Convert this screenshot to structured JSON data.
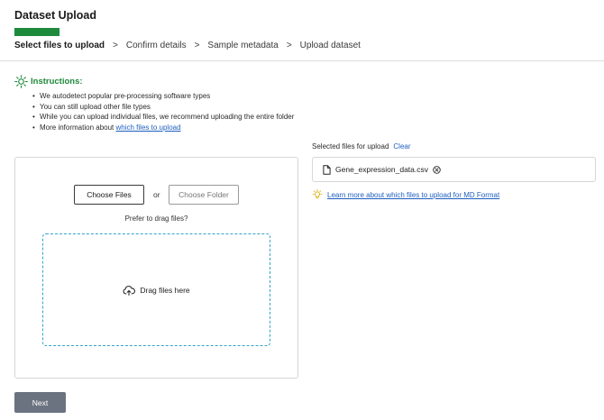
{
  "header": {
    "title": "Dataset Upload",
    "progress_fraction": 0.25,
    "steps": [
      {
        "label": "Select files to upload",
        "active": true
      },
      {
        "label": "Confirm details",
        "active": false
      },
      {
        "label": "Sample metadata",
        "active": false
      },
      {
        "label": "Upload dataset",
        "active": false
      }
    ],
    "separator": ">"
  },
  "instructions": {
    "title": "Instructions:",
    "icon": "lightbulb-icon",
    "items": [
      "We autodetect popular pre-processing software types",
      "You can still upload other file types",
      "While you can upload individual files, we recommend uploading the entire folder"
    ],
    "more_info_prefix": "More information about ",
    "more_info_link": "which files to upload"
  },
  "upload": {
    "choose_files_label": "Choose Files",
    "or_label": "or",
    "choose_folder_label": "Choose Folder",
    "prefer_drag_label": "Prefer to drag files?",
    "drag_here_label": "Drag files here",
    "drag_icon": "cloud-upload-icon"
  },
  "selected": {
    "label": "Selected files for upload",
    "clear_label": "Clear",
    "files": [
      {
        "name": "Gene_expression_data.csv",
        "icon": "file-icon"
      }
    ],
    "learn_more": "Learn more about which files to upload for MD Format"
  },
  "footer": {
    "next_label": "Next"
  },
  "colors": {
    "accent_green": "#1e8a3c",
    "link_blue": "#1f5fbf",
    "dashed_border": "#35a3c8",
    "next_button": "#6c7380"
  }
}
